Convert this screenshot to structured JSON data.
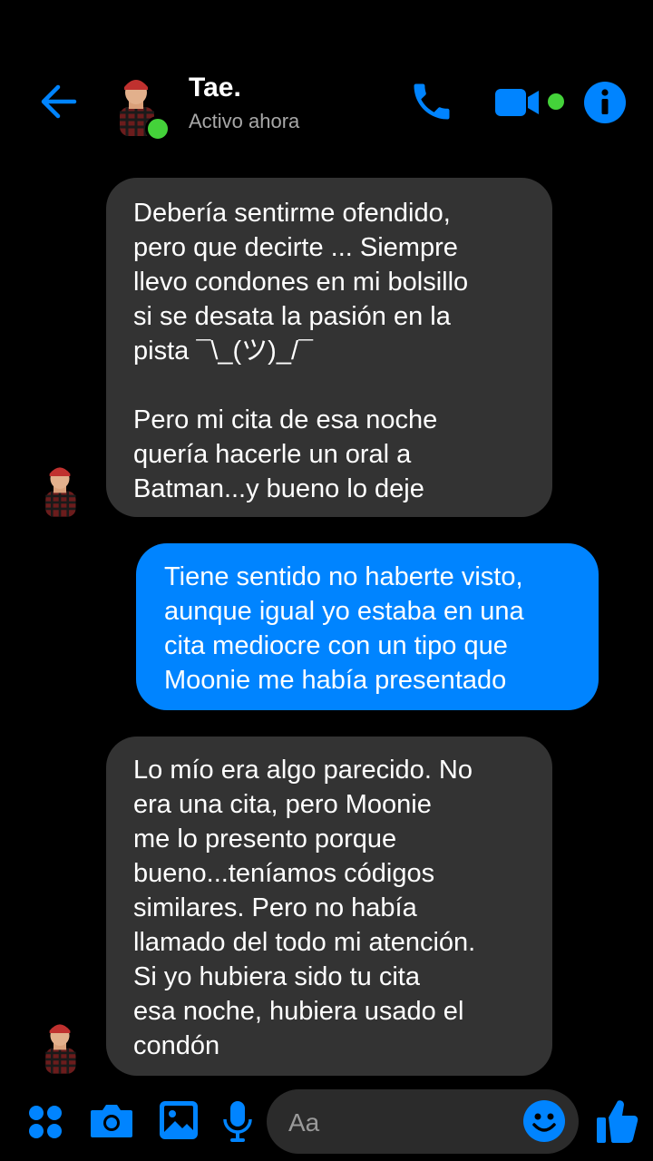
{
  "header": {
    "contact_name": "Tae.",
    "status": "Activo ahora",
    "icons": [
      "back-arrow-icon",
      "phone-icon",
      "video-camera-icon",
      "info-icon"
    ]
  },
  "messages": [
    {
      "direction": "incoming",
      "text": "Debería sentirme ofendido,\npero que decirte ... Siempre\nllevo condones en mi bolsillo\nsi se desata la pasión en la\npista ¯\\_(ツ)_/¯\n\nPero mi cita de esa noche\nquería hacerle un oral a\nBatman...y bueno lo deje"
    },
    {
      "direction": "outgoing",
      "text": "Tiene sentido no haberte visto,\naunque igual yo estaba en una\ncita mediocre con un tipo que\nMoonie me había presentado"
    },
    {
      "direction": "incoming",
      "text": "Lo mío era algo parecido. No\nera una cita, pero Moonie\nme lo presento porque\nbueno...teníamos códigos\nsimilares. Pero no había\nllamado del todo mi atención.\nSi yo hubiera sido tu cita\nesa noche, hubiera usado el\ncondón"
    }
  ],
  "composer": {
    "placeholder": "Aa",
    "icons": [
      "apps-icon",
      "camera-icon",
      "gallery-icon",
      "microphone-icon",
      "emoji-icon",
      "thumbs-up-icon"
    ]
  },
  "colors": {
    "accent": "#0084ff",
    "incoming_bubble": "#333333",
    "online": "#44d23a",
    "background": "#000000"
  }
}
